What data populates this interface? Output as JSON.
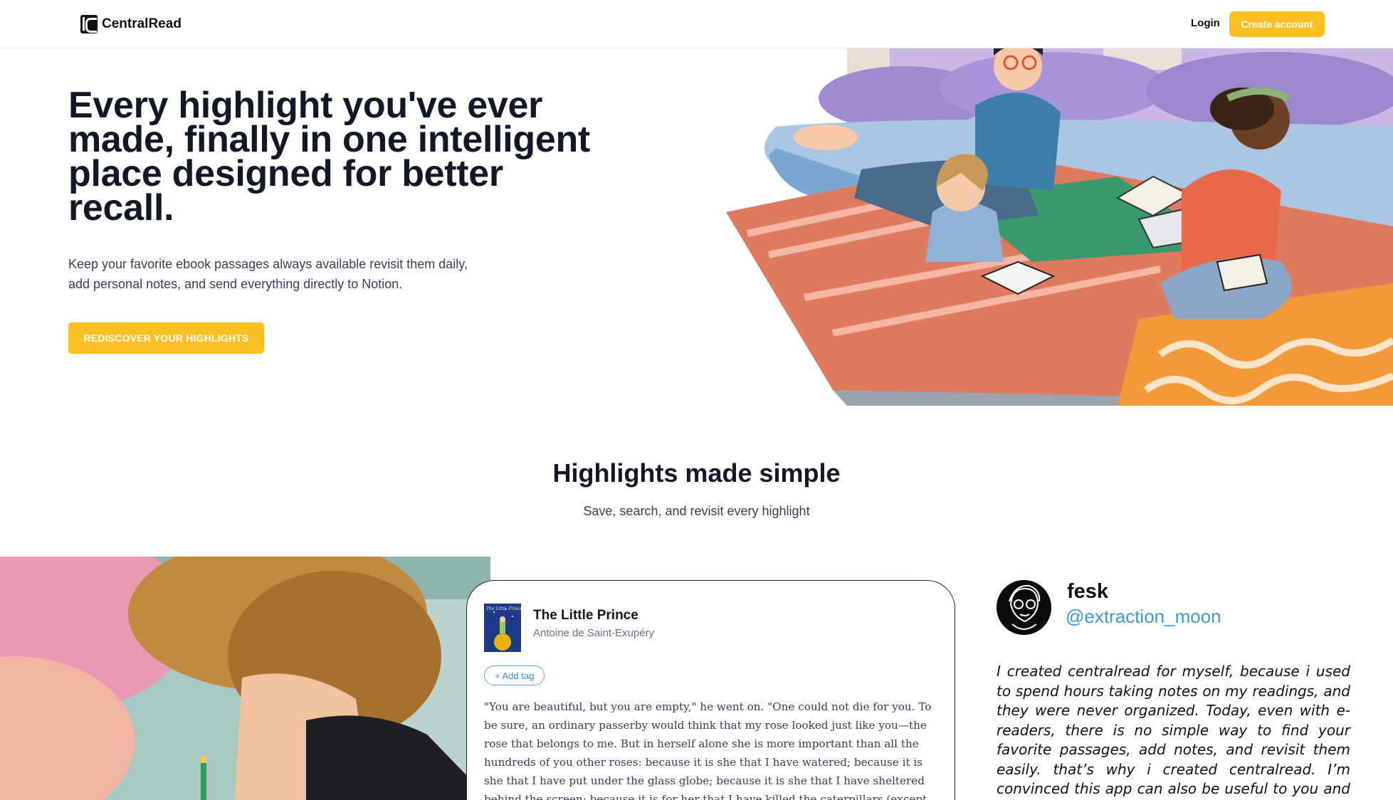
{
  "nav": {
    "brand": "CentralRead",
    "login_label": "Login",
    "create_account_label": "Create account"
  },
  "hero": {
    "title": "Every highlight you've ever made, finally in one intelligent place designed for better recall.",
    "subtitle_line1": "Keep your favorite ebook passages always available revisit them daily,",
    "subtitle_line2": "add personal notes, and send everything directly to Notion.",
    "cta_label": "REDISCOVER YOUR HIGHLIGHTS"
  },
  "section": {
    "title": "Highlights made simple",
    "subtitle": "Save, search, and revisit every highlight"
  },
  "highlight_card": {
    "book_title": "The Little Prince",
    "author": "Antoine de Saint-Exupéry",
    "add_tag_label": "+ Add tag",
    "passage": "\"You are beautiful, but you are empty,\" he went on. \"One could not die for you. To be sure, an ordinary passerby would think that my rose looked just like you—the rose that belongs to me. But in herself alone she is more important than all the hundreds of you other roses: because it is she that I have watered; because it is she that I have put under the glass globe; because it is she that I have sheltered behind the screen; because it is for her that I have killed the caterpillars (except the two or three that"
  },
  "testimonial": {
    "name": "fesk",
    "handle": "@extraction_moon",
    "quote": "I created centralread for myself, because i used to spend hours taking notes on my readings, and they were never organized. Today, even with e-readers, there is no simple way to find your favorite passages, add notes, and revisit them easily. that’s why i created centralread. I’m convinced this app can also be useful to you and transform the way"
  },
  "colors": {
    "accent": "#fbbf24",
    "link": "#3b9be0",
    "text": "#111827"
  }
}
